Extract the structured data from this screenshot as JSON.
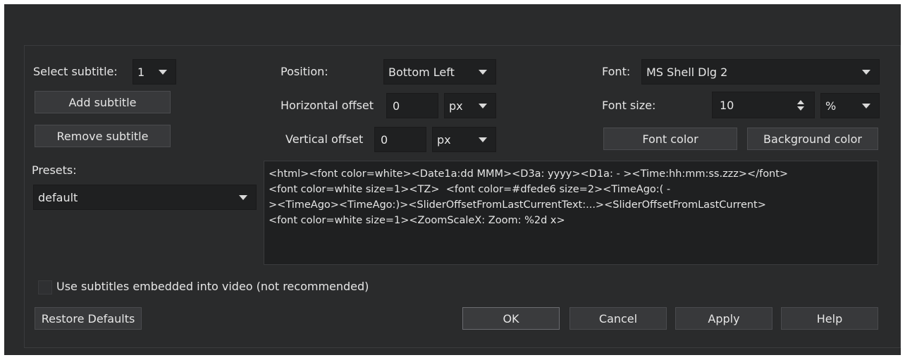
{
  "subtitle": {
    "select_label": "Select subtitle:",
    "selected": "1",
    "add_button": "Add subtitle",
    "remove_button": "Remove subtitle"
  },
  "presets": {
    "label": "Presets:",
    "selected": "default"
  },
  "position": {
    "label": "Position:",
    "selected": "Bottom Left",
    "horizontal_label": "Horizontal offset",
    "horizontal_value": "0",
    "horizontal_unit": "px",
    "vertical_label": "Vertical offset",
    "vertical_value": "0",
    "vertical_unit": "px"
  },
  "font": {
    "label": "Font:",
    "selected": "MS Shell Dlg 2",
    "size_label": "Font size:",
    "size_value": "10",
    "size_unit": "%",
    "color_button": "Font color",
    "bg_color_button": "Background color"
  },
  "template_text": "<html><font color=white><Date1a:dd MMM><D3a: yyyy><D1a: - ><Time:hh:mm:ss.zzz></font>\n<font color=white size=1><TZ>  <font color=#dfede6 size=2><TimeAgo:( -\n><TimeAgo><TimeAgo:)><SliderOffsetFromLastCurrentText:...><SliderOffsetFromLastCurrent>\n<font color=white size=1><ZoomScaleX: Zoom: %2d x>",
  "embedded": {
    "label": "Use subtitles embedded into video (not recommended)",
    "checked": false
  },
  "buttons": {
    "restore": "Restore Defaults",
    "ok": "OK",
    "cancel": "Cancel",
    "apply": "Apply",
    "help": "Help"
  }
}
